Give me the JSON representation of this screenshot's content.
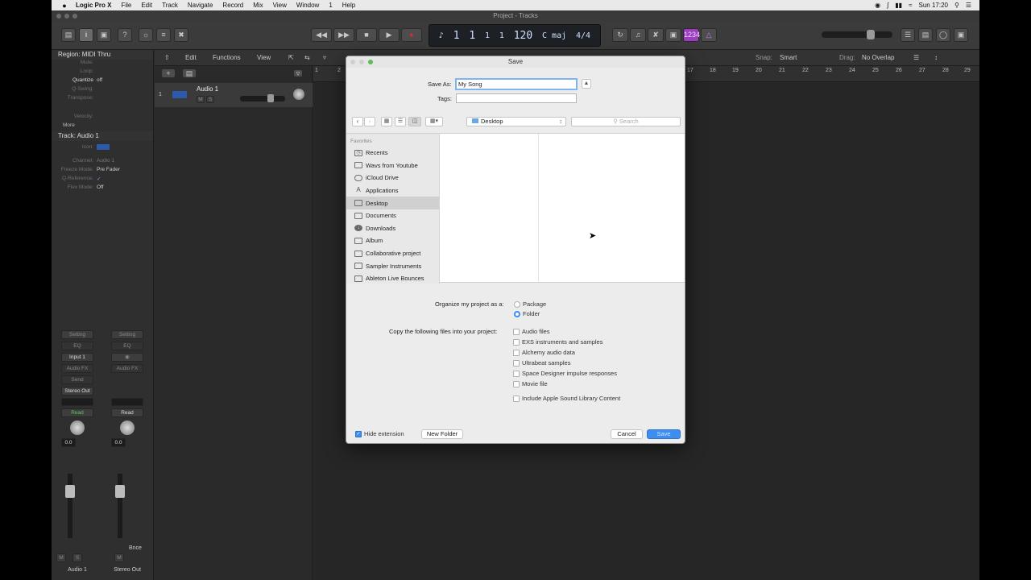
{
  "menubar": {
    "apple": "",
    "app": "Logic Pro X",
    "items": [
      "File",
      "Edit",
      "Track",
      "Navigate",
      "Record",
      "Mix",
      "View",
      "Window",
      "1",
      "Help"
    ],
    "clock": "Sun 17:20"
  },
  "window": {
    "title": "Project - Tracks"
  },
  "lcd": {
    "bar": "1",
    "beat": "1",
    "div": "1",
    "tick": "1",
    "tempo": "120",
    "key": "C maj",
    "signature": "4/4",
    "cycle": "1234"
  },
  "inspector": {
    "region_header": "Region: MIDI Thru",
    "region_rows": [
      {
        "k": "Mute:",
        "v": ""
      },
      {
        "k": "Loop:",
        "v": ""
      },
      {
        "k": "Quantize",
        "v": "off"
      },
      {
        "k": "Q-Swing:",
        "v": ""
      },
      {
        "k": "Transpose:",
        "v": ""
      },
      {
        "k": "Velocity:",
        "v": ""
      }
    ],
    "more": "More",
    "track_header": "Track: Audio 1",
    "track_rows": [
      {
        "k": "Icon:",
        "v": ""
      },
      {
        "k": "Channel:",
        "v": "Audio 1"
      },
      {
        "k": "Freeze Mode:",
        "v": "Pre Fader"
      },
      {
        "k": "Q-Reference:",
        "v": "✓"
      },
      {
        "k": "Flex Mode:",
        "v": "Off"
      }
    ],
    "strip1": {
      "setting": "Setting",
      "eq": "EQ",
      "input": "Input 1",
      "audiofx": "Audio FX",
      "send": "Send",
      "output": "Stereo Out",
      "auto": "Read",
      "value": "0.0",
      "m": "M",
      "s": "S",
      "name": "Audio 1"
    },
    "strip2": {
      "setting": "Setting",
      "eq": "EQ",
      "audiofx": "Audio FX",
      "auto": "Read",
      "value": "0.0",
      "m": "M",
      "bnce": "Bnce",
      "name": "Stereo Out"
    }
  },
  "tracks": {
    "menus": [
      "Edit",
      "Functions",
      "View"
    ],
    "snap_label": "Snap:",
    "snap_value": "Smart",
    "drag_label": "Drag:",
    "drag_value": "No Overlap",
    "track_number": "1",
    "track_name": "Audio 1",
    "m": "M",
    "s": "S",
    "ruler": [
      "1",
      "2",
      "17",
      "18",
      "19",
      "20",
      "21",
      "22",
      "23",
      "24",
      "25",
      "26",
      "27",
      "28",
      "29"
    ]
  },
  "dialog": {
    "title": "Save",
    "save_as_label": "Save As:",
    "save_as_value": "My Song",
    "tags_label": "Tags:",
    "location": "Desktop",
    "search_placeholder": "Search",
    "favorites_header": "Favorites",
    "favorites": [
      {
        "label": "Recents",
        "icon": "recents-icon",
        "selected": false
      },
      {
        "label": "Wavs from Youtube",
        "icon": "folder-icon",
        "selected": false
      },
      {
        "label": "iCloud Drive",
        "icon": "cloud-icon",
        "selected": false
      },
      {
        "label": "Applications",
        "icon": "applications-icon",
        "selected": false
      },
      {
        "label": "Desktop",
        "icon": "desktop-icon",
        "selected": true
      },
      {
        "label": "Documents",
        "icon": "documents-icon",
        "selected": false
      },
      {
        "label": "Downloads",
        "icon": "downloads-icon",
        "selected": false
      },
      {
        "label": "Album",
        "icon": "folder-icon",
        "selected": false
      },
      {
        "label": "Collaborative project",
        "icon": "folder-icon",
        "selected": false
      },
      {
        "label": "Sampler Instruments",
        "icon": "folder-icon",
        "selected": false
      },
      {
        "label": "Ableton Live Bounces",
        "icon": "folder-icon",
        "selected": false
      }
    ],
    "organize_label": "Organize my project as a:",
    "organize_options": [
      {
        "label": "Package",
        "selected": false
      },
      {
        "label": "Folder",
        "selected": true
      }
    ],
    "copy_label": "Copy the following files into your project:",
    "copy_options": [
      {
        "label": "Audio files",
        "checked": false
      },
      {
        "label": "EXS instruments and samples",
        "checked": false
      },
      {
        "label": "Alchemy audio data",
        "checked": false
      },
      {
        "label": "Ultrabeat samples",
        "checked": false
      },
      {
        "label": "Space Designer impulse responses",
        "checked": false
      },
      {
        "label": "Movie file",
        "checked": false
      }
    ],
    "apple_sound_label": "Include Apple Sound Library Content",
    "apple_sound_checked": false,
    "hide_extension_label": "Hide extension",
    "hide_extension_checked": true,
    "new_folder_label": "New Folder",
    "cancel_label": "Cancel",
    "save_label": "Save"
  },
  "colors": {
    "accent": "#3d8ef0",
    "record": "#d0312d",
    "cycle": "#9b3fbf"
  }
}
